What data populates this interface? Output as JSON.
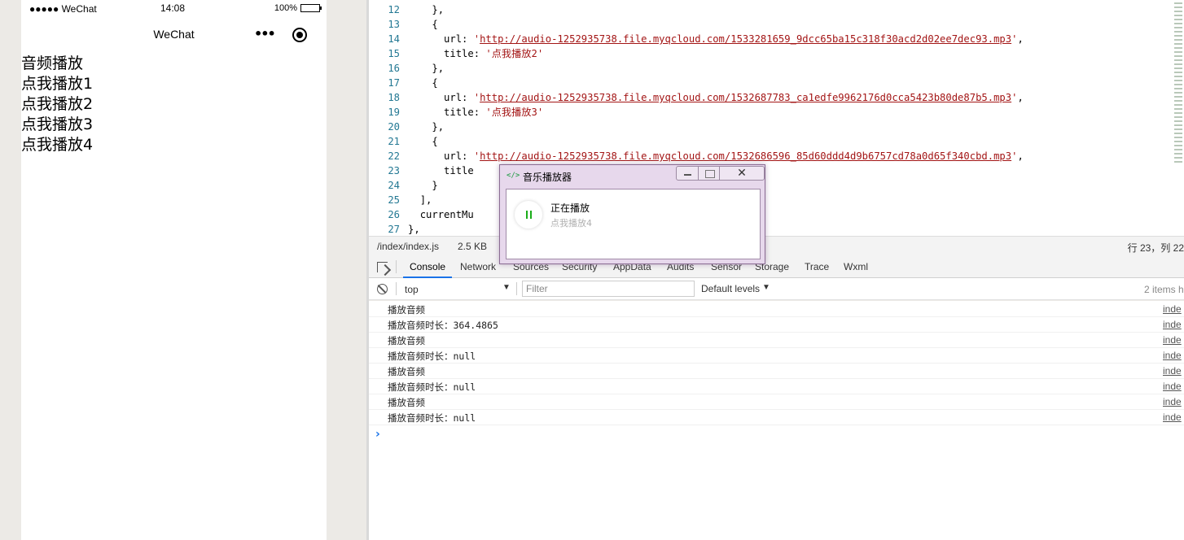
{
  "simulator": {
    "status_bar": {
      "carrier": "●●●●● WeChat",
      "time": "14:08",
      "battery": "100%"
    },
    "nav": {
      "title": "WeChat",
      "more": "•••"
    },
    "content": [
      "音频播放",
      "点我播放1",
      "点我播放2",
      "点我播放3",
      "点我播放4"
    ]
  },
  "editor": {
    "lines": [
      {
        "num": "12",
        "indent": "    ",
        "parts": [
          {
            "t": "},"
          }
        ]
      },
      {
        "num": "13",
        "indent": "    ",
        "parts": [
          {
            "t": "{"
          }
        ]
      },
      {
        "num": "14",
        "indent": "      ",
        "parts": [
          {
            "t": "url: "
          },
          {
            "t": "'",
            "c": "str"
          },
          {
            "t": "http://audio-1252935738.file.myqcloud.com/1533281659_9dcc65ba15c318f30acd2d02ee7dec93.mp3",
            "c": "url"
          },
          {
            "t": "'",
            "c": "str"
          },
          {
            "t": ","
          }
        ]
      },
      {
        "num": "15",
        "indent": "      ",
        "parts": [
          {
            "t": "title: "
          },
          {
            "t": "'点我播放2'",
            "c": "str"
          }
        ]
      },
      {
        "num": "16",
        "indent": "    ",
        "parts": [
          {
            "t": "},"
          }
        ]
      },
      {
        "num": "17",
        "indent": "    ",
        "parts": [
          {
            "t": "{"
          }
        ]
      },
      {
        "num": "18",
        "indent": "      ",
        "parts": [
          {
            "t": "url: "
          },
          {
            "t": "'",
            "c": "str"
          },
          {
            "t": "http://audio-1252935738.file.myqcloud.com/1532687783_ca1edfe9962176d0cca5423b80de87b5.mp3",
            "c": "url"
          },
          {
            "t": "'",
            "c": "str"
          },
          {
            "t": ","
          }
        ]
      },
      {
        "num": "19",
        "indent": "      ",
        "parts": [
          {
            "t": "title: "
          },
          {
            "t": "'点我播放3'",
            "c": "str"
          }
        ]
      },
      {
        "num": "20",
        "indent": "    ",
        "parts": [
          {
            "t": "},"
          }
        ]
      },
      {
        "num": "21",
        "indent": "    ",
        "parts": [
          {
            "t": "{"
          }
        ]
      },
      {
        "num": "22",
        "indent": "      ",
        "parts": [
          {
            "t": "url: "
          },
          {
            "t": "'",
            "c": "str"
          },
          {
            "t": "http://audio-1252935738.file.myqcloud.com/1532686596_85d60ddd4d9b6757cd78a0d65f340cbd.mp3",
            "c": "url"
          },
          {
            "t": "'",
            "c": "str"
          },
          {
            "t": ","
          }
        ]
      },
      {
        "num": "23",
        "indent": "      ",
        "parts": [
          {
            "t": "title"
          }
        ]
      },
      {
        "num": "24",
        "indent": "    ",
        "parts": [
          {
            "t": "}"
          }
        ]
      },
      {
        "num": "25",
        "indent": "  ",
        "parts": [
          {
            "t": "],"
          }
        ]
      },
      {
        "num": "26",
        "indent": "  ",
        "parts": [
          {
            "t": "currentMu"
          }
        ]
      },
      {
        "num": "27",
        "indent": "",
        "parts": [
          {
            "t": "},"
          }
        ]
      }
    ]
  },
  "file_status": {
    "path": "/index/index.js",
    "size": "2.5 KB",
    "position": "行 23，列 22"
  },
  "devtools": {
    "tabs": [
      "Console",
      "Network",
      "Sources",
      "Security",
      "AppData",
      "Audits",
      "Sensor",
      "Storage",
      "Trace",
      "Wxml"
    ],
    "active_tab": "Console"
  },
  "console_toolbar": {
    "context": "top",
    "filter_placeholder": "Filter",
    "levels": "Default levels",
    "items_hidden": "2 items h"
  },
  "console": {
    "logs": [
      {
        "msg": "播放音频",
        "src": "inde"
      },
      {
        "msg": "播放音频时长：364.4865",
        "src": "inde"
      },
      {
        "msg": "播放音频",
        "src": "inde"
      },
      {
        "msg": "播放音频时长：null",
        "src": "inde"
      },
      {
        "msg": "播放音频",
        "src": "inde"
      },
      {
        "msg": "播放音频时长：null",
        "src": "inde"
      },
      {
        "msg": "播放音频",
        "src": "inde"
      },
      {
        "msg": "播放音频时长：null",
        "src": "inde"
      }
    ],
    "prompt": "›"
  },
  "popup": {
    "icon": "</>",
    "title": "音乐播放器",
    "close": "✕",
    "status": "正在播放",
    "track": "点我播放4"
  },
  "colors": {
    "line_number": "#237893",
    "string": "#a31515",
    "active_tab_underline": "#1a73e8",
    "pause_icon": "#1aad19",
    "popup_frame": "#e7d8ec"
  }
}
